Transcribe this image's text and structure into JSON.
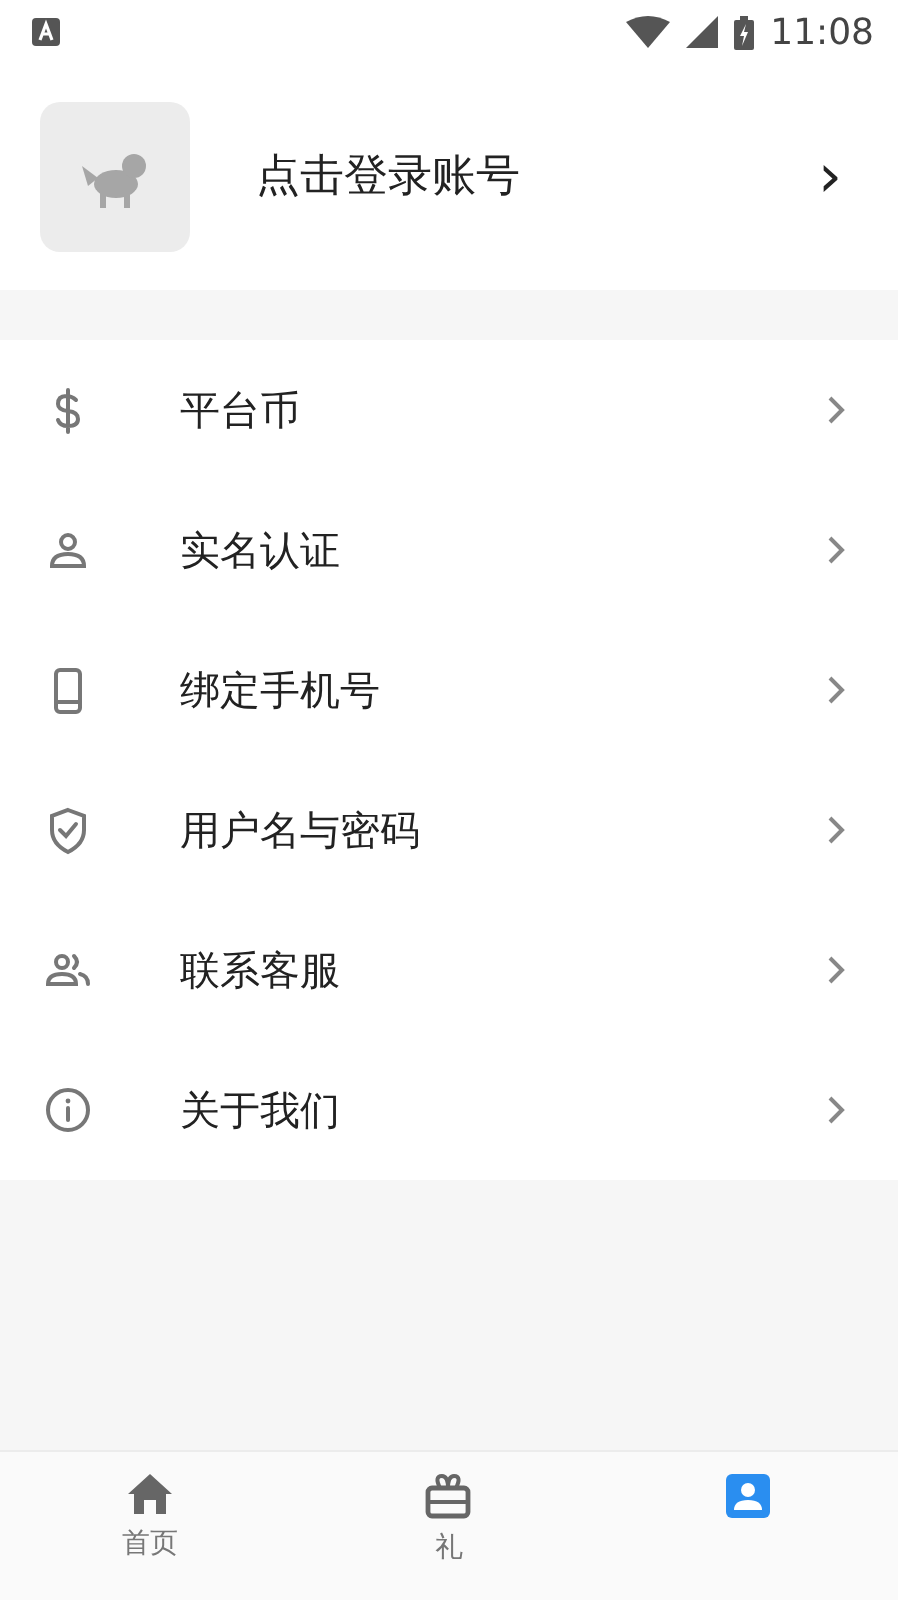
{
  "status_bar": {
    "time": "11:08"
  },
  "account": {
    "label": "点击登录账号",
    "chevron": "›"
  },
  "menu": [
    {
      "label": "平台币"
    },
    {
      "label": "实名认证"
    },
    {
      "label": "绑定手机号"
    },
    {
      "label": "用户名与密码"
    },
    {
      "label": "联系客服"
    },
    {
      "label": "关于我们"
    }
  ],
  "bottom_nav": [
    {
      "label": "首页",
      "selected": false
    },
    {
      "label": "礼",
      "selected": false
    },
    {
      "selected": true
    }
  ]
}
